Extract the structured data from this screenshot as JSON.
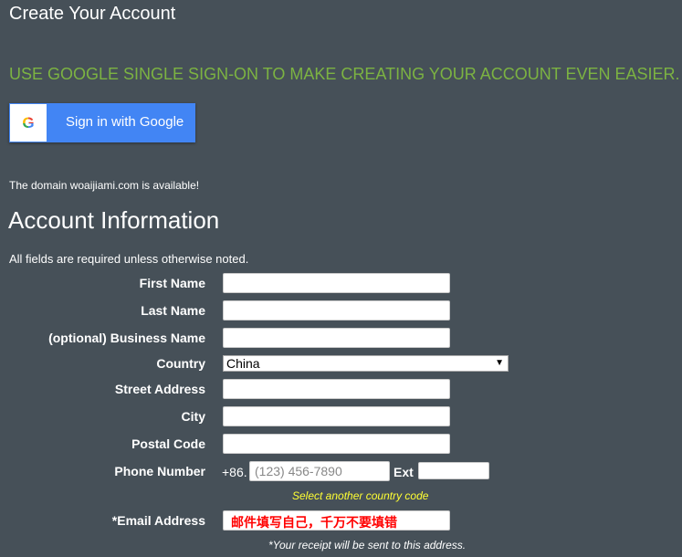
{
  "title": "Create Your Account",
  "sso_heading": "USE GOOGLE SINGLE SIGN-ON TO MAKE CREATING YOUR ACCOUNT EVEN EASIER.",
  "google_button": "Sign in with Google",
  "google_icon": "G",
  "domain_msg": "The domain woaijiami.com is available!",
  "section_title": "Account Information",
  "required_note": "All fields are required unless otherwise noted.",
  "labels": {
    "first": "First Name",
    "last": "Last Name",
    "business": "(optional) Business Name",
    "country": "Country",
    "street": "Street Address",
    "city": "City",
    "postal": "Postal Code",
    "phone": "Phone Number",
    "email": "*Email Address"
  },
  "country_value": "China",
  "phone_prefix": "+86.",
  "phone_placeholder": "(123) 456-7890",
  "ext_label": "Ext",
  "country_code_link": "Select another country code",
  "email_value": "邮件填写自己，千万不要填错",
  "receipt_note": "*Your receipt will be sent to this address."
}
